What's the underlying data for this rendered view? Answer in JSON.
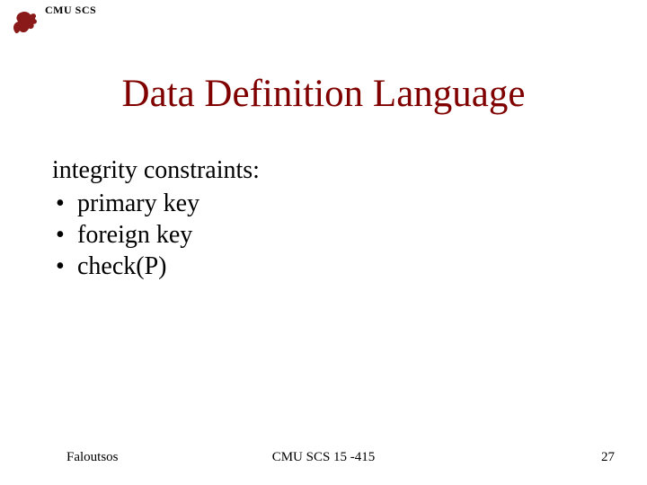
{
  "header": {
    "label": "CMU SCS"
  },
  "title": "Data Definition Language",
  "body": {
    "lead": "integrity constraints:",
    "bullets": [
      "primary key",
      "foreign key",
      "check(P)"
    ]
  },
  "footer": {
    "left": "Faloutsos",
    "center": "CMU SCS 15 -415",
    "right": "27"
  }
}
